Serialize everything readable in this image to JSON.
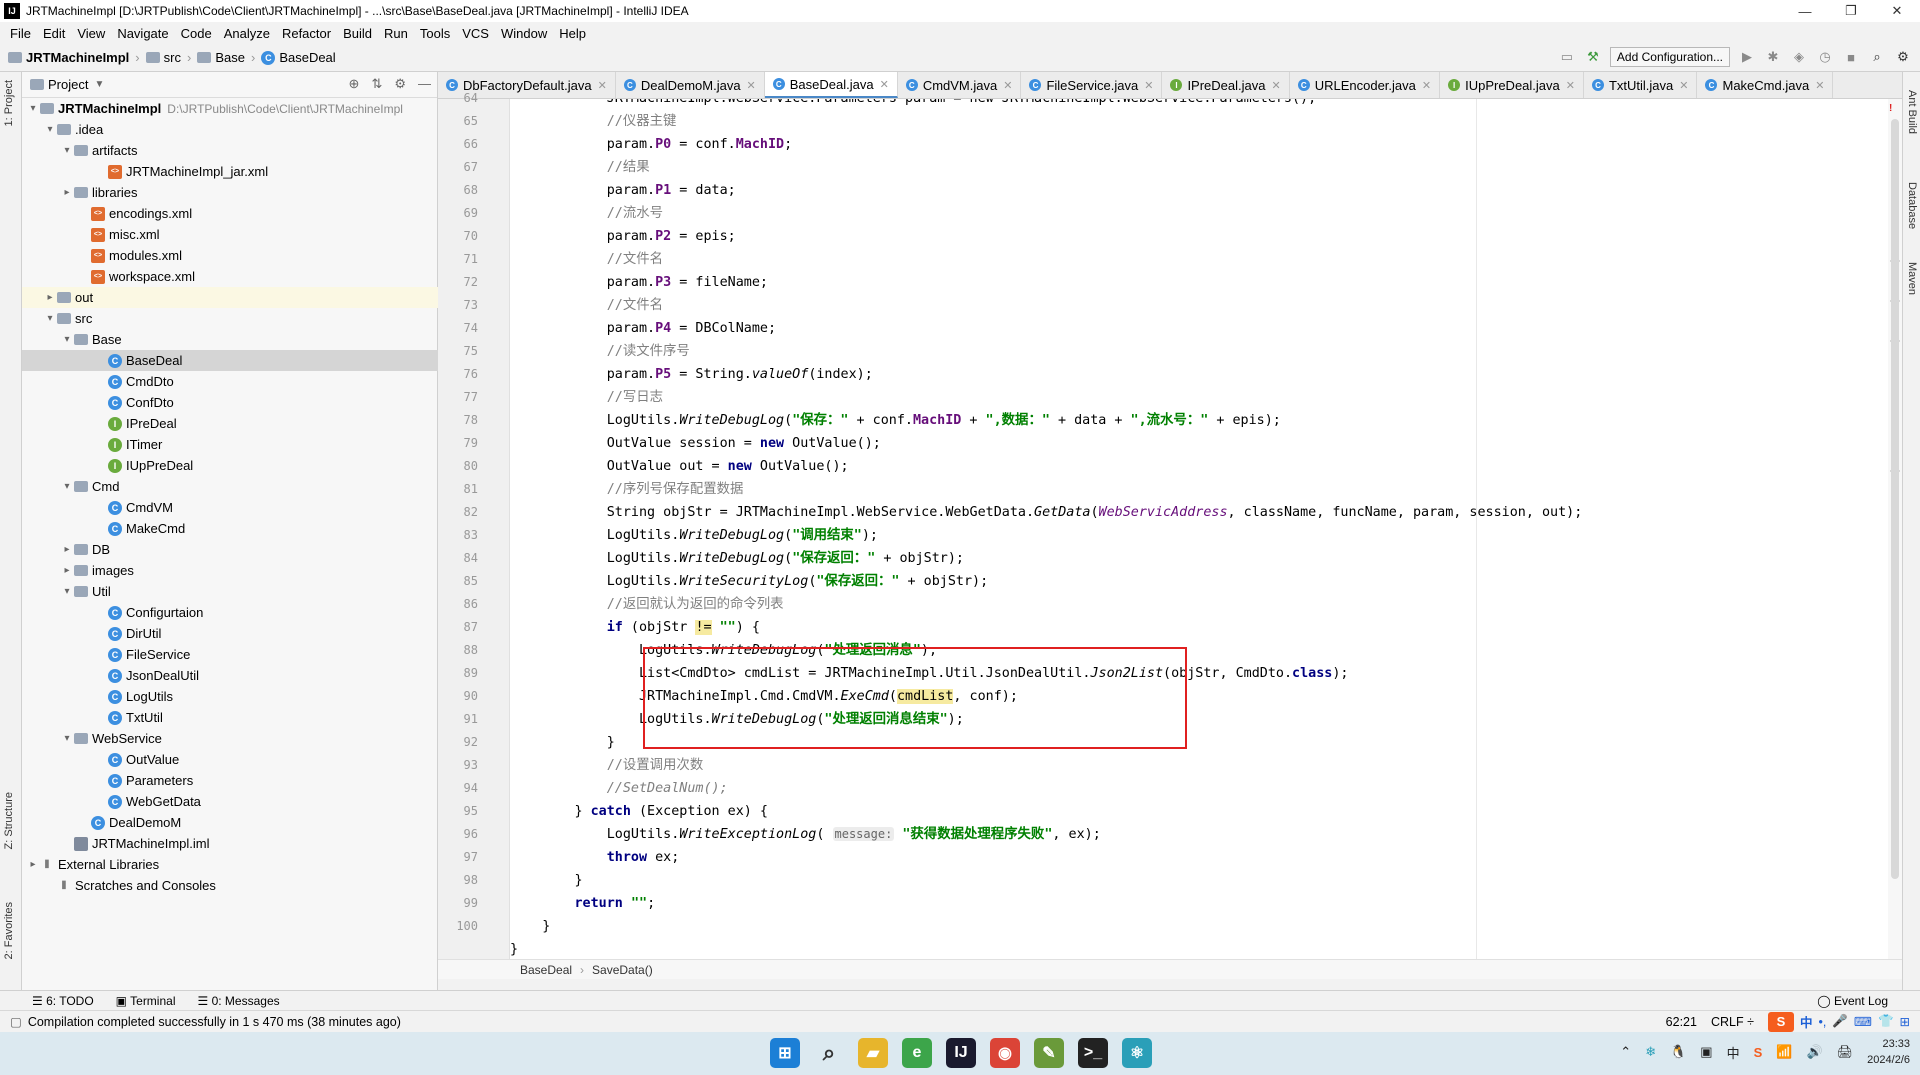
{
  "window": {
    "title": "JRTMachineImpl [D:\\JRTPublish\\Code\\Client\\JRTMachineImpl] - ...\\src\\Base\\BaseDeal.java [JRTMachineImpl] - IntelliJ IDEA",
    "app_icon": "IJ",
    "controls": [
      "—",
      "❐",
      "✕"
    ]
  },
  "menu": [
    "File",
    "Edit",
    "View",
    "Navigate",
    "Code",
    "Analyze",
    "Refactor",
    "Build",
    "Run",
    "Tools",
    "VCS",
    "Window",
    "Help"
  ],
  "breadcrumb": {
    "project": "JRTMachineImpl",
    "folder1": "src",
    "folder2": "Base",
    "file": "BaseDeal"
  },
  "toolbar": {
    "add_configuration": "Add Configuration..."
  },
  "left_strip": {
    "project_tab": "1: Project",
    "structure_tab": "Z: Structure",
    "favorites_tab": "2: Favorites"
  },
  "right_strip": {
    "ant": "Ant Build",
    "database": "Database",
    "maven": "Maven"
  },
  "project_panel": {
    "title": "Project",
    "tree": [
      {
        "label": "JRTMachineImpl",
        "path": "D:\\JRTPublish\\Code\\Client\\JRTMachineImpl",
        "icon": "folder",
        "arrow": "▾",
        "indent": 0,
        "bold": true
      },
      {
        "label": ".idea",
        "icon": "folder",
        "arrow": "▾",
        "indent": 1
      },
      {
        "label": "artifacts",
        "icon": "folder",
        "arrow": "▾",
        "indent": 2
      },
      {
        "label": "JRTMachineImpl_jar.xml",
        "icon": "xml",
        "arrow": "",
        "indent": 4
      },
      {
        "label": "libraries",
        "icon": "folder",
        "arrow": "▸",
        "indent": 2
      },
      {
        "label": "encodings.xml",
        "icon": "xml",
        "arrow": "",
        "indent": 3
      },
      {
        "label": "misc.xml",
        "icon": "xml",
        "arrow": "",
        "indent": 3
      },
      {
        "label": "modules.xml",
        "icon": "xml",
        "arrow": "",
        "indent": 3
      },
      {
        "label": "workspace.xml",
        "icon": "xml",
        "arrow": "",
        "indent": 3
      },
      {
        "label": "out",
        "icon": "folder",
        "arrow": "▸",
        "indent": 1,
        "state": "excl"
      },
      {
        "label": "src",
        "icon": "folder",
        "arrow": "▾",
        "indent": 1
      },
      {
        "label": "Base",
        "icon": "folder",
        "arrow": "▾",
        "indent": 2
      },
      {
        "label": "BaseDeal",
        "icon": "cls",
        "arrow": "",
        "indent": 4,
        "state": "sel"
      },
      {
        "label": "CmdDto",
        "icon": "cls",
        "arrow": "",
        "indent": 4
      },
      {
        "label": "ConfDto",
        "icon": "cls",
        "arrow": "",
        "indent": 4
      },
      {
        "label": "IPreDeal",
        "icon": "ifc",
        "arrow": "",
        "indent": 4
      },
      {
        "label": "ITimer",
        "icon": "ifc",
        "arrow": "",
        "indent": 4
      },
      {
        "label": "IUpPreDeal",
        "icon": "ifc",
        "arrow": "",
        "indent": 4
      },
      {
        "label": "Cmd",
        "icon": "folder",
        "arrow": "▾",
        "indent": 2
      },
      {
        "label": "CmdVM",
        "icon": "cls",
        "arrow": "",
        "indent": 4
      },
      {
        "label": "MakeCmd",
        "icon": "cls",
        "arrow": "",
        "indent": 4
      },
      {
        "label": "DB",
        "icon": "folder",
        "arrow": "▸",
        "indent": 2
      },
      {
        "label": "images",
        "icon": "folder",
        "arrow": "▸",
        "indent": 2
      },
      {
        "label": "Util",
        "icon": "folder",
        "arrow": "▾",
        "indent": 2
      },
      {
        "label": "Configurtaion",
        "icon": "cls",
        "arrow": "",
        "indent": 4
      },
      {
        "label": "DirUtil",
        "icon": "cls",
        "arrow": "",
        "indent": 4
      },
      {
        "label": "FileService",
        "icon": "cls",
        "arrow": "",
        "indent": 4
      },
      {
        "label": "JsonDealUtil",
        "icon": "cls",
        "arrow": "",
        "indent": 4
      },
      {
        "label": "LogUtils",
        "icon": "cls",
        "arrow": "",
        "indent": 4
      },
      {
        "label": "TxtUtil",
        "icon": "cls",
        "arrow": "",
        "indent": 4
      },
      {
        "label": "WebService",
        "icon": "folder",
        "arrow": "▾",
        "indent": 2
      },
      {
        "label": "OutValue",
        "icon": "cls",
        "arrow": "",
        "indent": 4
      },
      {
        "label": "Parameters",
        "icon": "cls",
        "arrow": "",
        "indent": 4
      },
      {
        "label": "WebGetData",
        "icon": "cls",
        "arrow": "",
        "indent": 4
      },
      {
        "label": "DealDemoM",
        "icon": "cls",
        "arrow": "",
        "indent": 3
      },
      {
        "label": "JRTMachineImpl.iml",
        "icon": "iml",
        "arrow": "",
        "indent": 2
      },
      {
        "label": "External Libraries",
        "icon": "lib",
        "arrow": "▸",
        "indent": 0
      },
      {
        "label": "Scratches and Consoles",
        "icon": "lib",
        "arrow": "",
        "indent": 1
      }
    ]
  },
  "tabs": [
    {
      "label": "DbFactoryDefault.java",
      "icon": "C",
      "color": "#3c8fe0"
    },
    {
      "label": "DealDemoM.java",
      "icon": "C",
      "color": "#3c8fe0"
    },
    {
      "label": "BaseDeal.java",
      "icon": "C",
      "color": "#3c8fe0",
      "active": true
    },
    {
      "label": "CmdVM.java",
      "icon": "C",
      "color": "#3c8fe0"
    },
    {
      "label": "FileService.java",
      "icon": "C",
      "color": "#3c8fe0"
    },
    {
      "label": "IPreDeal.java",
      "icon": "I",
      "color": "#6aab3d"
    },
    {
      "label": "URLEncoder.java",
      "icon": "C",
      "color": "#3c8fe0"
    },
    {
      "label": "IUpPreDeal.java",
      "icon": "I",
      "color": "#6aab3d"
    },
    {
      "label": "TxtUtil.java",
      "icon": "C",
      "color": "#3c8fe0"
    },
    {
      "label": "MakeCmd.java",
      "icon": "C",
      "color": "#3c8fe0"
    }
  ],
  "code": {
    "line_numbers": [
      "64",
      "65",
      "66",
      "67",
      "68",
      "69",
      "70",
      "71",
      "72",
      "73",
      "74",
      "75",
      "76",
      "77",
      "78",
      "79",
      "80",
      "81",
      "82",
      "83",
      "84",
      "85",
      "86",
      "87",
      "88",
      "89",
      "90",
      "91",
      "92",
      "93",
      "94",
      "95",
      "96",
      "97",
      "98",
      "99",
      "100"
    ],
    "first_line_partial": "            JRTMachineImpl.WebService.Parameters param = new JRTMachineImpl.WebService.Parameters();"
  },
  "editor_breadcrumb": [
    "BaseDeal",
    "SaveData()"
  ],
  "toolwindows": {
    "todo": "6: TODO",
    "terminal": "Terminal",
    "messages": "0: Messages",
    "event_log": "Event Log"
  },
  "status": {
    "message": "Compilation completed successfully in 1 s 470 ms (38 minutes ago)",
    "position": "62:21",
    "line_sep": "CRLF ÷",
    "ime": [
      "中",
      "•,",
      "🎤",
      "⌨",
      "👕",
      "⊞"
    ]
  },
  "taskbar": {
    "apps": [
      {
        "name": "windows-start",
        "glyph": "⊞",
        "color": "#1c7fd6"
      },
      {
        "name": "search",
        "glyph": "⌕",
        "color": "#333333"
      },
      {
        "name": "file-explorer",
        "glyph": "▰",
        "color": "#e7b52c"
      },
      {
        "name": "browser-green",
        "glyph": "e",
        "color": "#3ca54a"
      },
      {
        "name": "intellij",
        "glyph": "IJ",
        "color": "#1a1a2e"
      },
      {
        "name": "chrome",
        "glyph": "◉",
        "color": "#db4437"
      },
      {
        "name": "notepad",
        "glyph": "✎",
        "color": "#6a9a3a"
      },
      {
        "name": "terminal",
        "glyph": ">_",
        "color": "#222222"
      },
      {
        "name": "react-app",
        "glyph": "⚛",
        "color": "#2a9fb8"
      }
    ],
    "clock_time": "23:33",
    "clock_date": "2024/2/6",
    "tray": [
      "⌃",
      "❄",
      "🐧",
      "▣",
      "中",
      "S",
      "📶",
      "🔊",
      "🖨"
    ]
  }
}
